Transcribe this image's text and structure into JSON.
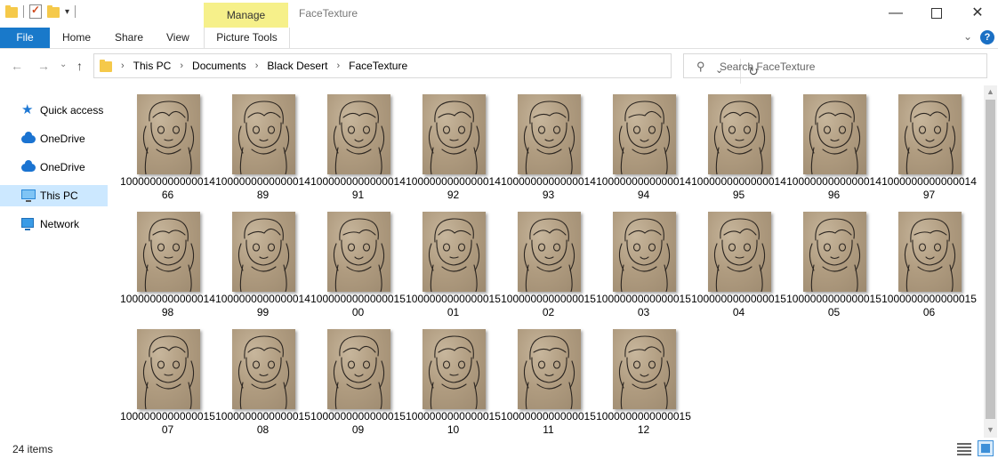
{
  "window": {
    "title": "FaceTexture",
    "minimize_icon": "minimize-icon",
    "maximize_icon": "maximize-icon",
    "close_icon": "close-icon"
  },
  "quick_access_toolbar": {
    "icons": [
      "folder-icon",
      "properties-check-icon",
      "new-folder-icon",
      "customize-dropdown-icon"
    ]
  },
  "ribbon": {
    "contextual_group": "Manage",
    "tabs": [
      "File",
      "Home",
      "Share",
      "View",
      "Picture Tools"
    ],
    "collapse_icon": "chevron-down-icon",
    "help_icon": "help-icon",
    "help_glyph": "?"
  },
  "address_bar": {
    "breadcrumbs": [
      "This PC",
      "Documents",
      "Black Desert",
      "FaceTexture"
    ]
  },
  "search": {
    "placeholder": "Search FaceTexture"
  },
  "sidebar": {
    "items": [
      {
        "label": "Quick access",
        "icon": "star-icon",
        "selected": false
      },
      {
        "label": "OneDrive",
        "icon": "cloud-icon",
        "selected": false
      },
      {
        "label": "OneDrive",
        "icon": "cloud-icon",
        "selected": false
      },
      {
        "label": "This PC",
        "icon": "computer-icon",
        "selected": true
      },
      {
        "label": "Network",
        "icon": "network-icon",
        "selected": false
      }
    ]
  },
  "files": [
    {
      "name": "100000000000001466",
      "type": "image"
    },
    {
      "name": "100000000000001489",
      "type": "image"
    },
    {
      "name": "100000000000001491",
      "type": "image"
    },
    {
      "name": "100000000000001492",
      "type": "image"
    },
    {
      "name": "100000000000001493",
      "type": "image"
    },
    {
      "name": "100000000000001494",
      "type": "image"
    },
    {
      "name": "100000000000001495",
      "type": "image"
    },
    {
      "name": "100000000000001496",
      "type": "image"
    },
    {
      "name": "100000000000001497",
      "type": "image"
    },
    {
      "name": "100000000000001498",
      "type": "image"
    },
    {
      "name": "100000000000001499",
      "type": "image"
    },
    {
      "name": "100000000000001500",
      "type": "image"
    },
    {
      "name": "100000000000001501",
      "type": "image"
    },
    {
      "name": "100000000000001502",
      "type": "image"
    },
    {
      "name": "100000000000001503",
      "type": "image"
    },
    {
      "name": "100000000000001504",
      "type": "image"
    },
    {
      "name": "100000000000001505",
      "type": "image"
    },
    {
      "name": "100000000000001506",
      "type": "image"
    },
    {
      "name": "100000000000001507",
      "type": "image"
    },
    {
      "name": "100000000000001508",
      "type": "image"
    },
    {
      "name": "100000000000001509",
      "type": "image"
    },
    {
      "name": "100000000000001510",
      "type": "image"
    },
    {
      "name": "100000000000001511",
      "type": "image"
    },
    {
      "name": "100000000000001512",
      "type": "image"
    }
  ],
  "status_bar": {
    "item_count": "24 items",
    "view_icons": [
      "details-view-icon",
      "large-icons-view-icon"
    ]
  },
  "colors": {
    "file_tab": "#1979ca",
    "contextual_tab": "#f6f08a",
    "selection": "#cce8ff"
  }
}
